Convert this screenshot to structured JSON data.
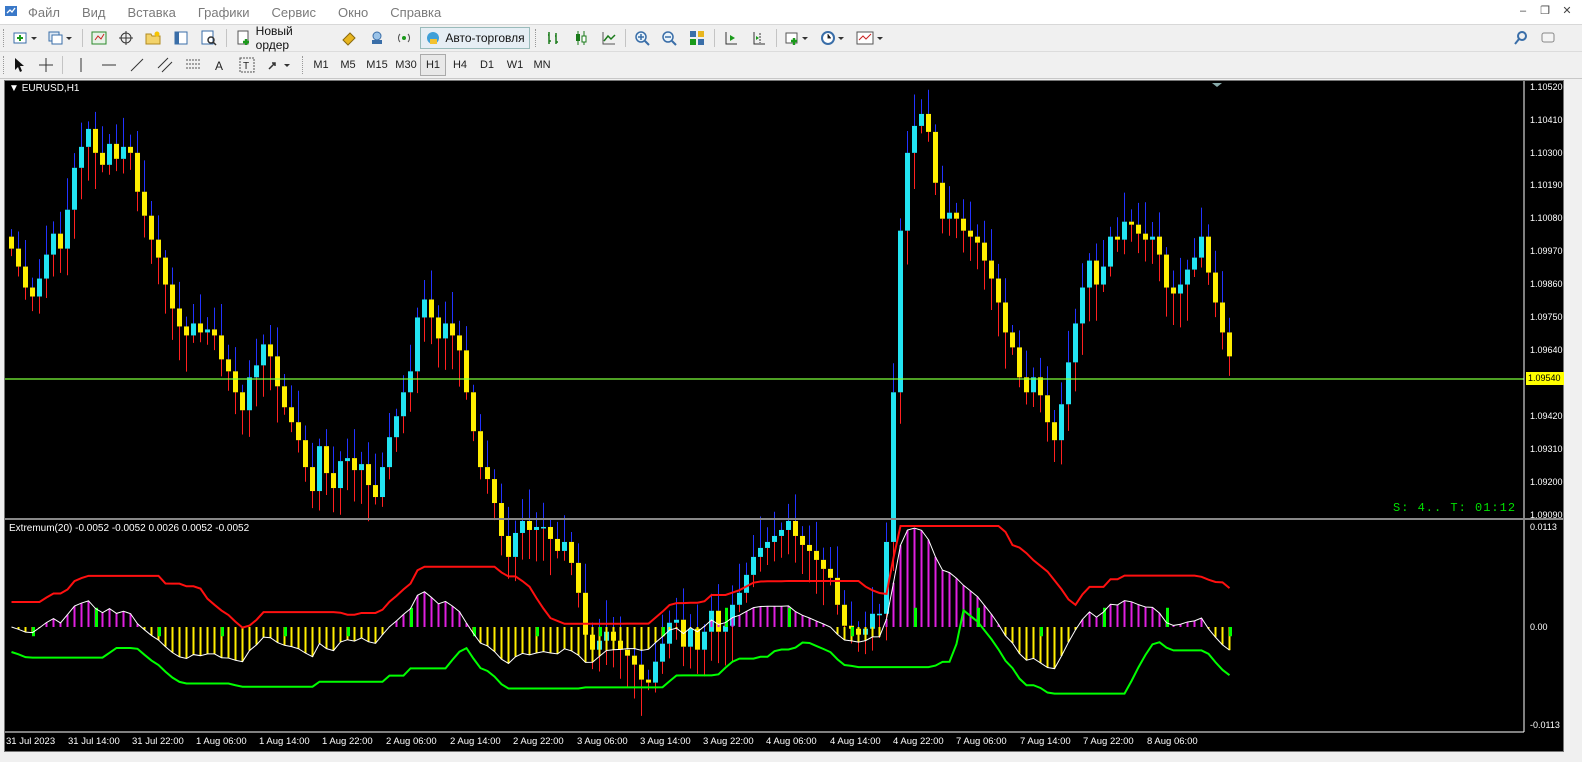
{
  "menu": [
    "Файл",
    "Вид",
    "Вставка",
    "Графики",
    "Сервис",
    "Окно",
    "Справка"
  ],
  "toolbar": {
    "new_order": "Новый ордер",
    "auto_trading": "Авто-торговля",
    "notifications_count": "1"
  },
  "timeframes": [
    "M1",
    "M5",
    "M15",
    "M30",
    "H1",
    "H4",
    "D1",
    "W1",
    "MN"
  ],
  "active_timeframe": "H1",
  "chart": {
    "symbol_label": "EURUSD,H1",
    "indicator_label": "Extremum(20) -0.0052 -0.0052 0.0026 0.0052 -0.0052",
    "timer_text": "S: 4.. T: 01:12",
    "price_ticks": [
      "1.10520",
      "1.10410",
      "1.10300",
      "1.10190",
      "1.10080",
      "1.09970",
      "1.09860",
      "1.09750",
      "1.09640",
      "1.09530",
      "1.09420",
      "1.09310",
      "1.09200",
      "1.09090"
    ],
    "current_price": "1.09540",
    "indicator_ticks": [
      "0.0113",
      "0.00",
      "-0.0113"
    ],
    "time_labels": [
      "31 Jul 2023",
      "31 Jul 14:00",
      "31 Jul 22:00",
      "1 Aug 06:00",
      "1 Aug 14:00",
      "1 Aug 22:00",
      "2 Aug 06:00",
      "2 Aug 14:00",
      "2 Aug 22:00",
      "3 Aug 06:00",
      "3 Aug 14:00",
      "3 Aug 22:00",
      "4 Aug 06:00",
      "4 Aug 14:00",
      "4 Aug 22:00",
      "7 Aug 06:00",
      "7 Aug 14:00",
      "7 Aug 22:00",
      "8 Aug 06:00"
    ],
    "colors": {
      "bull": "#22e4f2",
      "bear": "#ffee00",
      "wick_up": "#2233ff",
      "wick_down": "#ff2020",
      "price_line": "#7cff3a",
      "ind_pos": "#e020e0",
      "ind_neg": "#ffee00",
      "ind_green": "#00ff00",
      "upper_env": "#ff1010",
      "lower_env": "#00ff00",
      "extremum_line": "#ffffff"
    }
  },
  "chart_data": {
    "type": "candlestick",
    "symbol": "EURUSD",
    "timeframe": "H1",
    "price_axis_ylim": [
      1.0909,
      1.1052
    ],
    "current_price": 1.0954,
    "closes": [
      1.0998,
      1.0992,
      1.0985,
      1.0982,
      1.0988,
      1.0996,
      1.1003,
      1.0998,
      1.1011,
      1.1025,
      1.1032,
      1.1038,
      1.103,
      1.1026,
      1.1033,
      1.1028,
      1.1032,
      1.103,
      1.1017,
      1.1009,
      1.1001,
      1.0995,
      1.0986,
      1.0978,
      1.0972,
      1.0969,
      1.0973,
      1.097,
      1.0971,
      1.0969,
      1.0961,
      1.0957,
      1.095,
      1.0944,
      1.0955,
      1.0959,
      1.0966,
      1.0962,
      1.0952,
      1.0945,
      1.094,
      1.0934,
      1.0925,
      1.0917,
      1.0932,
      1.0923,
      1.0918,
      1.0927,
      1.0928,
      1.0924,
      1.0926,
      1.0919,
      1.0915,
      1.0925,
      1.0935,
      1.0942,
      1.095,
      1.0957,
      1.0975,
      1.0981,
      1.0975,
      1.0968,
      1.0973,
      1.0969,
      1.0964,
      1.095,
      1.0937,
      1.0925,
      1.0921,
      1.0913,
      1.0902,
      1.0895,
      1.0903,
      1.0907,
      1.0904,
      1.0905,
      1.0905,
      1.0901,
      1.0897,
      1.09,
      1.0893,
      1.0883,
      1.0869,
      1.0864,
      1.0867,
      1.087,
      1.0867,
      1.0864,
      1.0862,
      1.0859,
      1.0854,
      1.0853,
      1.086,
      1.0866,
      1.0873,
      1.0874,
      1.0865,
      1.0871,
      1.0864,
      1.087,
      1.0877,
      1.087,
      1.0872,
      1.0879,
      1.0883,
      1.0889,
      1.0895,
      1.0898,
      1.09,
      1.0902,
      1.0904,
      1.0907,
      1.0902,
      1.0899,
      1.0897,
      1.0894,
      1.0891,
      1.0888,
      1.0879,
      1.0872,
      1.0871,
      1.0869,
      1.0871,
      1.0876,
      1.0876,
      1.09,
      1.095,
      1.1004,
      1.103,
      1.1039,
      1.1043,
      1.1037,
      1.102,
      1.1008,
      1.101,
      1.1008,
      1.1004,
      1.1002,
      1.1,
      1.0994,
      1.0988,
      1.098,
      1.097,
      1.0965,
      1.0955,
      1.095,
      1.0955,
      1.0949,
      1.094,
      1.0934,
      1.0946,
      1.096,
      1.0973,
      1.0985,
      1.0994,
      1.0986,
      1.0992,
      1.1002,
      1.1001,
      1.1007,
      1.1006,
      1.1003,
      1.1001,
      1.1002,
      1.0996,
      1.0985,
      1.0983,
      1.0986,
      1.0991,
      1.0995,
      1.1002,
      1.099,
      1.098,
      1.097,
      1.0962
    ]
  }
}
